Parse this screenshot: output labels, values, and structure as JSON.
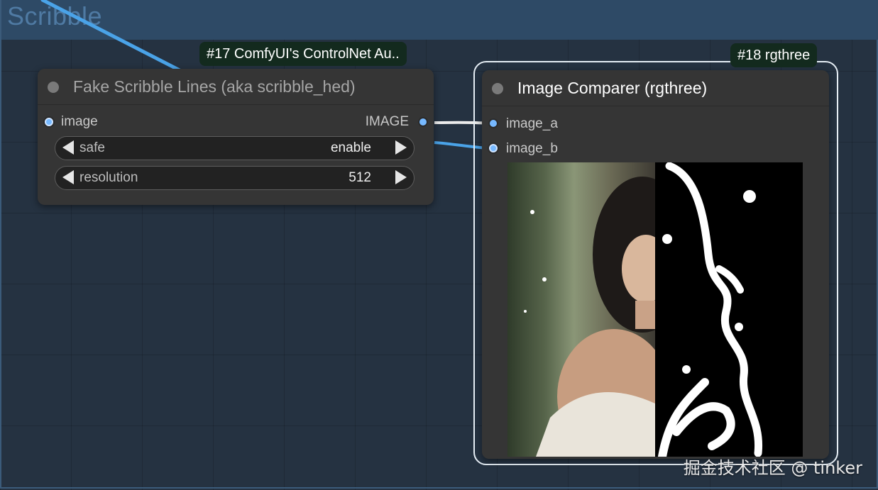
{
  "group": {
    "title": "Scribble"
  },
  "node17": {
    "badge": "#17 ComfyUI's ControlNet Au..",
    "title": "Fake Scribble Lines (aka scribble_hed)",
    "input_label": "image",
    "output_label": "IMAGE",
    "widgets": [
      {
        "name": "safe",
        "value": "enable"
      },
      {
        "name": "resolution",
        "value": "512"
      }
    ]
  },
  "node18": {
    "badge": "#18 rgthree",
    "title": "Image Comparer (rgthree)",
    "inputs": [
      "image_a",
      "image_b"
    ]
  },
  "watermark": "掘金技术社区 @ tinker",
  "colors": {
    "canvas": "#253241",
    "group_header": "#2e4a66",
    "node_bg": "#353535",
    "badge_bg": "#132a1e",
    "slot_image": "#77b9ff",
    "link_blue": "#4aa3e8"
  }
}
